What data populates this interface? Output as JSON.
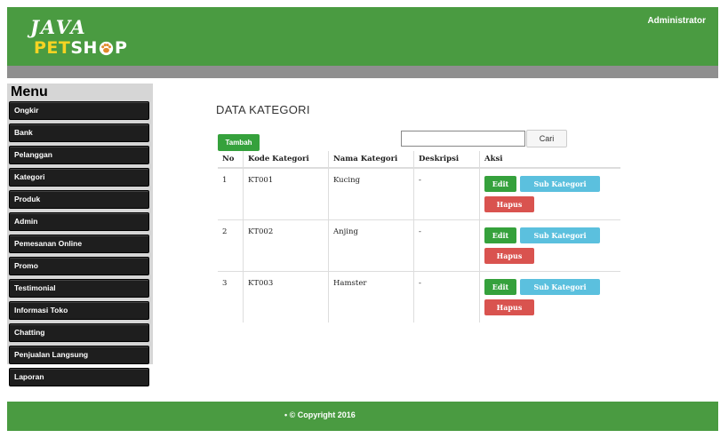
{
  "header": {
    "logo_top": "JAVA",
    "logo_pet": "PET",
    "logo_sh": "SH",
    "logo_p": "P",
    "admin_label": "Administrator"
  },
  "sidebar": {
    "title": "Menu",
    "items": [
      {
        "label": "Ongkir"
      },
      {
        "label": "Bank"
      },
      {
        "label": "Pelanggan"
      },
      {
        "label": "Kategori"
      },
      {
        "label": "Produk"
      },
      {
        "label": "Admin"
      },
      {
        "label": "Pemesanan Online"
      },
      {
        "label": "Promo"
      },
      {
        "label": "Testimonial"
      },
      {
        "label": "Informasi Toko"
      },
      {
        "label": "Chatting"
      },
      {
        "label": "Penjualan Langsung"
      },
      {
        "label": "Laporan"
      }
    ]
  },
  "main": {
    "title": "DATA KATEGORI",
    "add_button": "Tambah",
    "search": {
      "value": "",
      "button": "Cari"
    },
    "table": {
      "headers": [
        "No",
        "Kode Kategori",
        "Nama Kategori",
        "Deskripsi",
        "Aksi"
      ],
      "rows": [
        {
          "no": "1",
          "kode": "KT001",
          "nama": "Kucing",
          "deskripsi": "-"
        },
        {
          "no": "2",
          "kode": "KT002",
          "nama": "Anjing",
          "deskripsi": "-"
        },
        {
          "no": "3",
          "kode": "KT003",
          "nama": "Hamster",
          "deskripsi": "-"
        }
      ],
      "actions": {
        "edit": "Edit",
        "sub": "Sub Kategori",
        "delete": "Hapus"
      }
    }
  },
  "footer": {
    "copyright": "• © Copyright 2016"
  },
  "colors": {
    "brand_green": "#4a9b41",
    "logo_yellow": "#f6d323",
    "btn_green": "#35a13c",
    "btn_info": "#5bc0de",
    "btn_danger": "#d9534f"
  }
}
